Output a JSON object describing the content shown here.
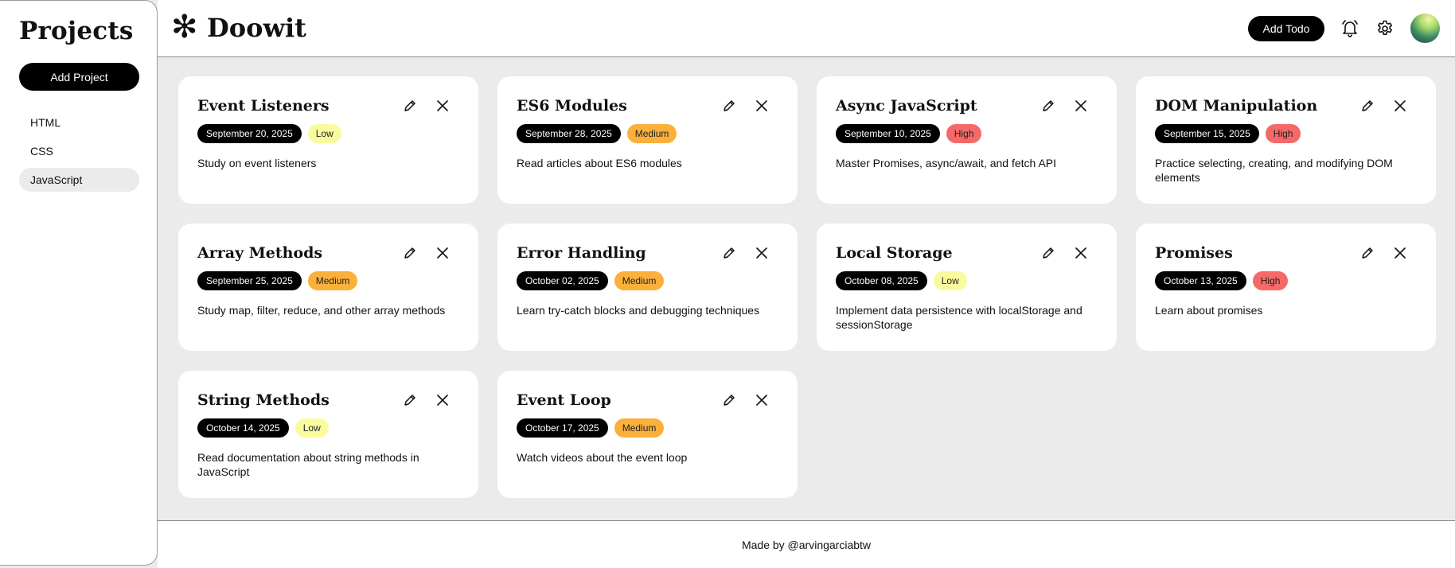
{
  "sidebar": {
    "title": "Projects",
    "add_project_label": "Add Project",
    "projects": [
      {
        "label": "HTML"
      },
      {
        "label": "CSS"
      },
      {
        "label": "JavaScript"
      }
    ],
    "active_project": "JavaScript"
  },
  "header": {
    "logo_icon": "✻",
    "app_title": "Doowit",
    "add_todo_label": "Add Todo",
    "icons": [
      "bell-icon",
      "gear-icon",
      "avatar"
    ]
  },
  "colors": {
    "Low": "#fafa9e",
    "Medium": "#fbb03b",
    "High": "#f56969"
  },
  "todos": [
    {
      "title": "Event Listeners",
      "date": "September 20, 2025",
      "priority": "Low",
      "description": "Study on event listeners"
    },
    {
      "title": "ES6 Modules",
      "date": "September 28, 2025",
      "priority": "Medium",
      "description": "Read articles about ES6 modules"
    },
    {
      "title": "Async JavaScript",
      "date": "September 10, 2025",
      "priority": "High",
      "description": "Master Promises, async/await, and fetch API"
    },
    {
      "title": "DOM Manipulation",
      "date": "September 15, 2025",
      "priority": "High",
      "description": "Practice selecting, creating, and modifying DOM elements"
    },
    {
      "title": "Array Methods",
      "date": "September 25, 2025",
      "priority": "Medium",
      "description": "Study map, filter, reduce, and other array methods"
    },
    {
      "title": "Error Handling",
      "date": "October 02, 2025",
      "priority": "Medium",
      "description": "Learn try-catch blocks and debugging techniques"
    },
    {
      "title": "Local Storage",
      "date": "October 08, 2025",
      "priority": "Low",
      "description": "Implement data persistence with localStorage and sessionStorage"
    },
    {
      "title": "Promises",
      "date": "October 13, 2025",
      "priority": "High",
      "description": "Learn about promises"
    },
    {
      "title": "String Methods",
      "date": "October 14, 2025",
      "priority": "Low",
      "description": "Read documentation about string methods in JavaScript"
    },
    {
      "title": "Event Loop",
      "date": "October 17, 2025",
      "priority": "Medium",
      "description": "Watch videos about the event loop"
    }
  ],
  "footer": {
    "credit": "Made by @arvingarciabtw"
  }
}
